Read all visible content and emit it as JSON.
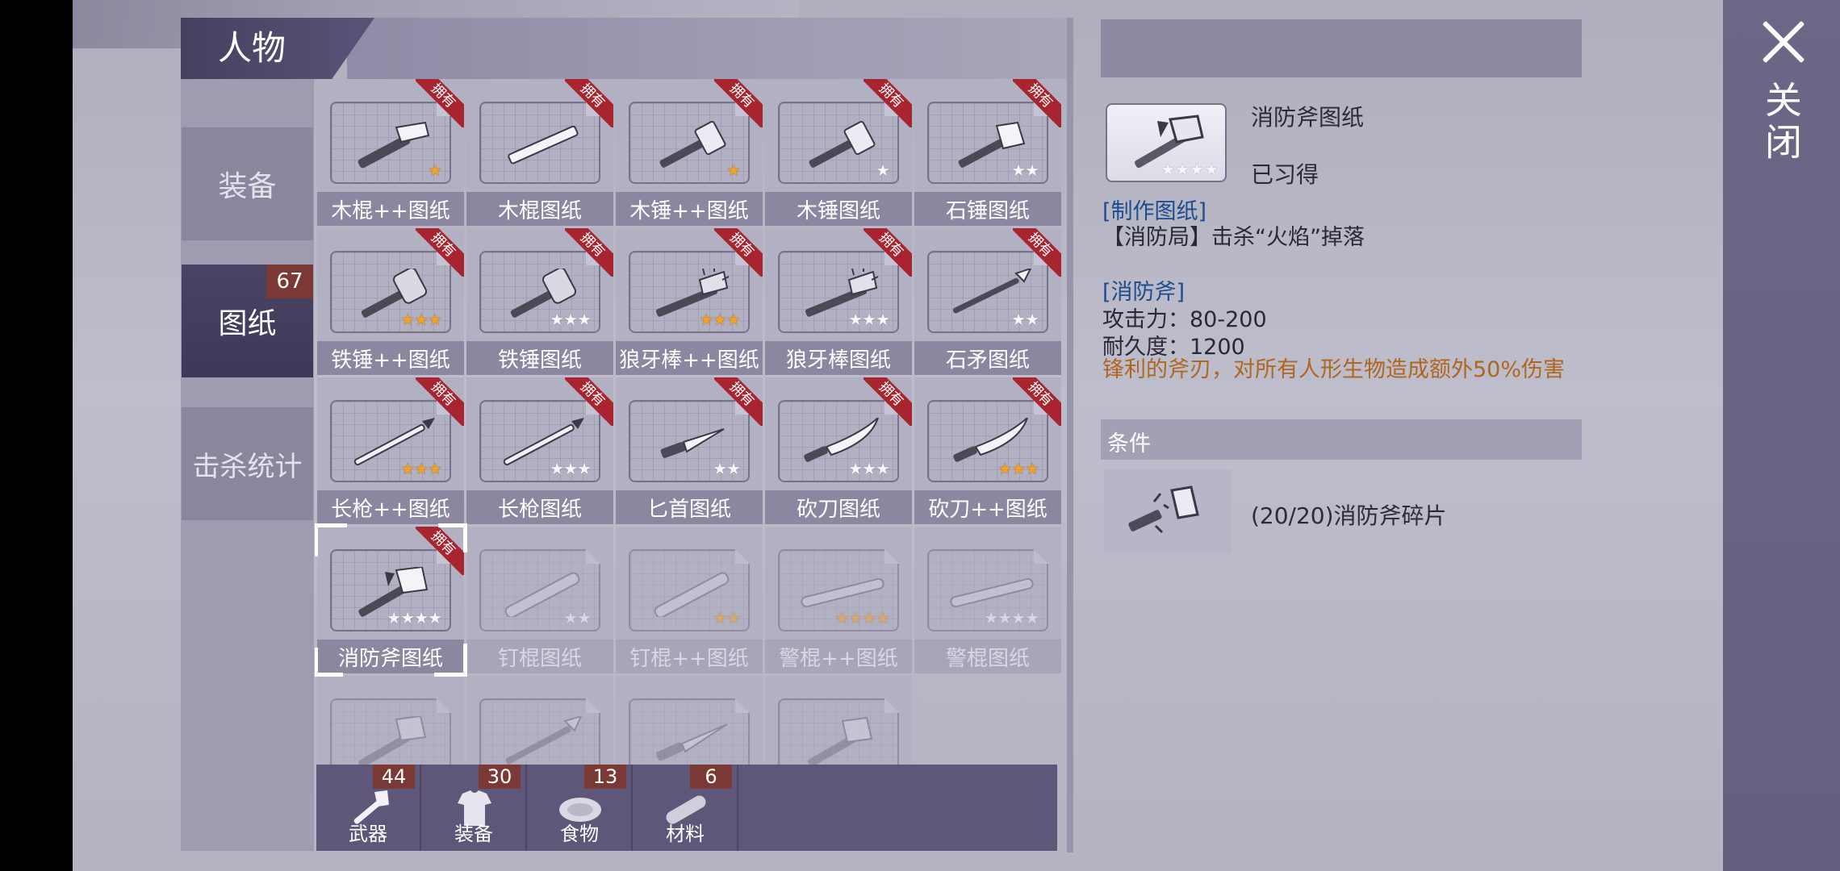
{
  "window": {
    "title": "人物",
    "close_label": "关闭"
  },
  "side_tabs": [
    {
      "label": "装备",
      "active": false
    },
    {
      "label": "图纸",
      "active": true,
      "badge": "67"
    },
    {
      "label": "击杀统计",
      "active": false
    }
  ],
  "grid": {
    "owned_tag": "拥有",
    "items": [
      {
        "name": "木棍++图纸",
        "stars": 1,
        "lit": 1,
        "owned": true,
        "icon": "wood-club-icon"
      },
      {
        "name": "木棍图纸",
        "stars": 0,
        "lit": 0,
        "owned": true,
        "icon": "wood-stick-icon"
      },
      {
        "name": "木锤++图纸",
        "stars": 1,
        "lit": 1,
        "owned": true,
        "icon": "wood-hammer-icon"
      },
      {
        "name": "木锤图纸",
        "stars": 1,
        "lit": 0,
        "owned": true,
        "icon": "wood-hammer-icon"
      },
      {
        "name": "石锤图纸",
        "stars": 2,
        "lit": 0,
        "owned": true,
        "icon": "stone-hammer-icon"
      },
      {
        "name": "铁锤++图纸",
        "stars": 3,
        "lit": 3,
        "owned": true,
        "icon": "iron-hammer-icon"
      },
      {
        "name": "铁锤图纸",
        "stars": 3,
        "lit": 0,
        "owned": true,
        "icon": "iron-hammer-icon"
      },
      {
        "name": "狼牙棒++图纸",
        "stars": 3,
        "lit": 3,
        "owned": true,
        "icon": "spiked-club-icon"
      },
      {
        "name": "狼牙棒图纸",
        "stars": 3,
        "lit": 0,
        "owned": true,
        "icon": "spiked-club-icon"
      },
      {
        "name": "石矛图纸",
        "stars": 2,
        "lit": 0,
        "owned": true,
        "icon": "stone-spear-icon"
      },
      {
        "name": "长枪++图纸",
        "stars": 3,
        "lit": 3,
        "owned": true,
        "icon": "long-spear-icon"
      },
      {
        "name": "长枪图纸",
        "stars": 3,
        "lit": 0,
        "owned": true,
        "icon": "long-spear-icon"
      },
      {
        "name": "匕首图纸",
        "stars": 2,
        "lit": 0,
        "owned": true,
        "icon": "dagger-icon"
      },
      {
        "name": "砍刀图纸",
        "stars": 3,
        "lit": 0,
        "owned": true,
        "icon": "machete-icon"
      },
      {
        "name": "砍刀++图纸",
        "stars": 3,
        "lit": 3,
        "owned": true,
        "icon": "machete-icon"
      },
      {
        "name": "消防斧图纸",
        "stars": 4,
        "lit": 0,
        "owned": true,
        "icon": "fire-axe-icon",
        "selected": true
      },
      {
        "name": "钉棍图纸",
        "stars": 2,
        "lit": 0,
        "owned": false,
        "icon": "nail-bat-icon"
      },
      {
        "name": "钉棍++图纸",
        "stars": 2,
        "lit": 2,
        "owned": false,
        "icon": "nail-bat-icon"
      },
      {
        "name": "警棍++图纸",
        "stars": 4,
        "lit": 4,
        "owned": false,
        "icon": "baton-icon"
      },
      {
        "name": "警棍图纸",
        "stars": 4,
        "lit": 0,
        "owned": false,
        "icon": "baton-icon"
      },
      {
        "name": "",
        "stars": 0,
        "lit": 0,
        "owned": false,
        "icon": "axe-hammer-icon"
      },
      {
        "name": "",
        "stars": 0,
        "lit": 0,
        "owned": false,
        "icon": "spiked-spear-icon"
      },
      {
        "name": "",
        "stars": 0,
        "lit": 0,
        "owned": false,
        "icon": "knife-icon"
      },
      {
        "name": "",
        "stars": 0,
        "lit": 0,
        "owned": false,
        "icon": "hatchet-icon"
      }
    ]
  },
  "categories": [
    {
      "label": "武器",
      "count": "44",
      "icon": "axe-icon"
    },
    {
      "label": "装备",
      "count": "30",
      "icon": "shirt-icon"
    },
    {
      "label": "食物",
      "count": "13",
      "icon": "meat-icon"
    },
    {
      "label": "材料",
      "count": "6",
      "icon": "wood-log-icon"
    }
  ],
  "detail": {
    "name": "消防斧图纸",
    "status": "已习得",
    "stars": 4,
    "section_make": "[制作图纸]",
    "source": "【消防局】击杀“火焰”掉落",
    "section_item": "[消防斧]",
    "attack": "攻击力：80-200",
    "durability": "耐久度：1200",
    "description": "锋利的斧刃，对所有人形生物造成额外50%伤害",
    "conditions_label": "条件",
    "material": "(20/20)消防斧碎片"
  }
}
